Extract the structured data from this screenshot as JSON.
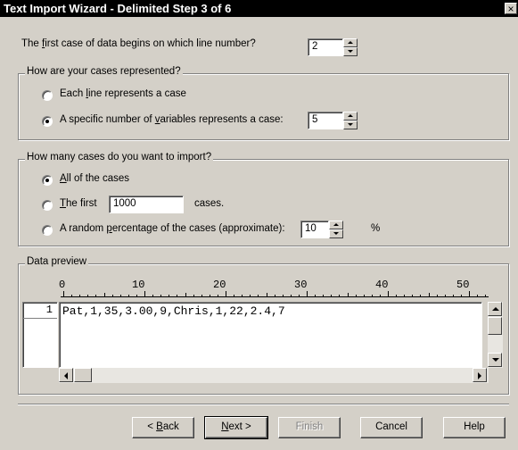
{
  "window": {
    "title": "Text Import Wizard - Delimited Step 3 of 6",
    "close_glyph": "×"
  },
  "first_case": {
    "label_pre": "The ",
    "label_u": "f",
    "label_post": "irst case of data begins on which line number?",
    "value": "2"
  },
  "cases_represented": {
    "legend": "How are your cases represented?",
    "option_line": {
      "pre": "Each ",
      "u": "l",
      "post": "ine represents a case"
    },
    "option_vars": {
      "pre": "A specific number of ",
      "u": "v",
      "post": "ariables represents a case:"
    },
    "vars_value": "5",
    "selected": "vars"
  },
  "cases_import": {
    "legend": "How many cases do you want to import?",
    "option_all": {
      "pre": "",
      "u": "A",
      "post": "ll of the cases"
    },
    "option_first": {
      "pre": "",
      "u": "T",
      "post": "he first"
    },
    "first_value": "1000",
    "first_suffix": "cases.",
    "option_random": {
      "pre": "A random ",
      "u": "p",
      "post": "ercentage of the cases (approximate):"
    },
    "random_value": "10",
    "percent_sign": "%",
    "selected": "all"
  },
  "preview": {
    "legend": "Data preview",
    "ruler_labels": [
      "0",
      "10",
      "20",
      "30",
      "40",
      "50"
    ],
    "rows": [
      {
        "num": "1",
        "text": "Pat,1,35,3.00,9,Chris,1,22,2.4,7"
      }
    ]
  },
  "buttons": {
    "back": {
      "pre": "< ",
      "u": "B",
      "post": "ack"
    },
    "next": {
      "pre": "",
      "u": "N",
      "post": "ext >"
    },
    "finish": "Finish",
    "cancel": "Cancel",
    "help": "Help"
  },
  "colors": {
    "face": "#d4d0c8",
    "titlebar": "#000000",
    "title_text": "#ffffff"
  }
}
